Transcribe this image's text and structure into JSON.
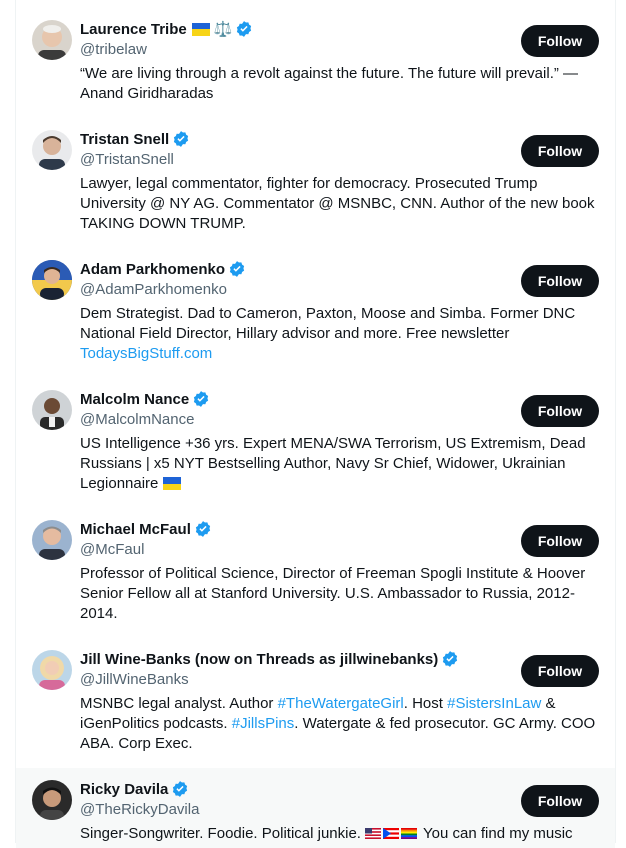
{
  "follow_label": "Follow",
  "colors": {
    "accent": "#1d9bf0",
    "follow_bg": "#0f1419",
    "handle": "#536471"
  },
  "accounts": [
    {
      "name": "Laurence Tribe",
      "handle": "@tribelaw",
      "bio": "“We are living through a revolt against the future. The future will prevail.” — Anand Giridharadas",
      "name_emoji": "⚖️"
    },
    {
      "name": "Tristan Snell",
      "handle": "@TristanSnell",
      "bio": "Lawyer, legal commentator, fighter for democracy. Prosecuted Trump University @ NY AG. Commentator @ MSNBC, CNN. Author of the new book TAKING DOWN TRUMP."
    },
    {
      "name": "Adam Parkhomenko",
      "handle": "@AdamParkhomenko",
      "bio": "Dem Strategist. Dad to Cameron, Paxton, Moose and Simba. Former DNC National Field Director, Hillary advisor and more. Free newsletter ",
      "bio_link": "TodaysBigStuff.com"
    },
    {
      "name": "Malcolm Nance",
      "handle": "@MalcolmNance",
      "bio": "US Intelligence +36 yrs. Expert MENA/SWA Terrorism, US Extremism, Dead Russians | x5 NYT Bestselling Author, Navy Sr Chief, Widower, Ukrainian Legionnaire "
    },
    {
      "name": "Michael McFaul",
      "handle": "@McFaul",
      "bio": "Professor of Political Science, Director of Freeman Spogli Institute & Hoover Senior Fellow all at Stanford University. U.S. Ambassador to Russia, 2012-2014."
    },
    {
      "name": "Jill Wine-Banks (now on Threads as jillwinebanks)",
      "handle": "@JillWineBanks",
      "bio_parts": {
        "p1": "MSNBC legal analyst. Author ",
        "l1": "#TheWatergateGirl",
        "p2": ". Host ",
        "l2": "#SistersInLaw",
        "p3": " & iGenPolitics podcasts. ",
        "l3": "#JillsPins",
        "p4": ". Watergate & fed prosecutor. GC Army. COO ABA. Corp Exec."
      }
    },
    {
      "name": "Ricky Davila",
      "handle": "@TheRickyDavila",
      "bio_start": "Singer-Songwriter. Foodie. Political junkie. ",
      "bio_end": " You can find my music"
    }
  ]
}
